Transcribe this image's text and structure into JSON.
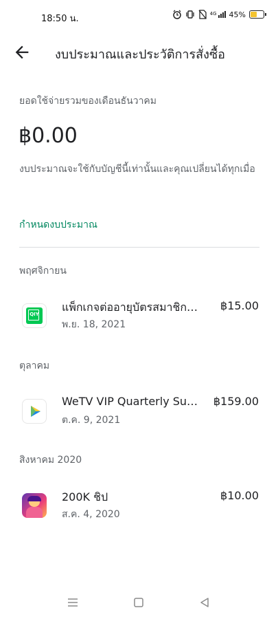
{
  "status": {
    "time": "18:50 น.",
    "battery": "45%",
    "battery_level": 0.45,
    "signal_label": "4G"
  },
  "header": {
    "title": "งบประมาณและประวัติการสั่งซื้อ"
  },
  "summary": {
    "spend_label": "ยอดใช้จ่ายรวมของเดือนธันวาคม",
    "amount": "฿0.00",
    "description": "งบประมาณจะใช้กับบัญชีนี้เท่านั้นและคุณเปลี่ยนได้ทุกเมื่อ",
    "set_budget": "กำหนดงบประมาณ"
  },
  "sections": [
    {
      "header": "พฤศจิกายน",
      "item": {
        "title": "แพ็กเกจต่ออายุบัตรสมาชิกรายเดือน",
        "date": "พ.ย. 18, 2021",
        "price": "฿15.00",
        "icon": "iqiyi-app-icon",
        "icon_text": "QIY",
        "icon_color": "#00c853"
      }
    },
    {
      "header": "ตุลาคม",
      "item": {
        "title": "WeTV VIP Quarterly Subscription",
        "date": "ต.ค. 9, 2021",
        "price": "฿159.00",
        "icon": "wetv-app-icon"
      }
    },
    {
      "header": "สิงหาคม 2020",
      "item": {
        "title": "200K ชิป",
        "date": "ส.ค. 4, 2020",
        "price": "฿10.00",
        "icon": "game-app-icon"
      }
    }
  ],
  "colors": {
    "accent": "#01875f",
    "text_primary": "#202124",
    "text_secondary": "#5f6368",
    "divider": "#dadce0"
  }
}
